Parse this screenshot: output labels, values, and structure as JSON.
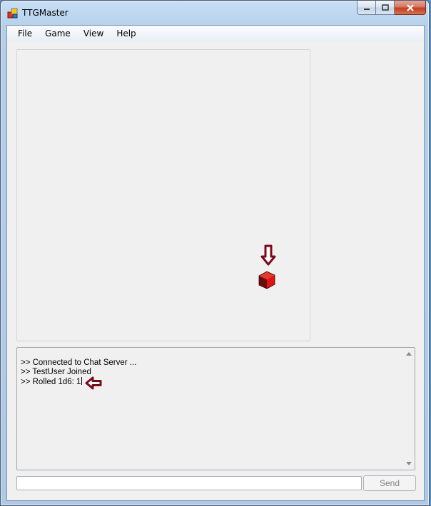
{
  "window": {
    "title": "TTGMaster",
    "app_icon": "ttgmaster-app-icon"
  },
  "titlebar_buttons": [
    "minimize-icon",
    "maximize-icon",
    "close-icon"
  ],
  "menubar": {
    "items": [
      "File",
      "Game",
      "View",
      "Help"
    ]
  },
  "board": {
    "token_icon": "red-cube-die-icon",
    "annotation_icon": "down-arrow-icon"
  },
  "chat": {
    "lines": [
      ">> Connected to Chat Server ...",
      ">> TestUser Joined",
      ">> Rolled 1d6: 1"
    ],
    "annotation_icon": "left-arrow-icon"
  },
  "input": {
    "value": "",
    "placeholder": ""
  },
  "send_button": {
    "label": "Send"
  },
  "colors": {
    "arrow": "#7a0a1a",
    "die": "#e01010",
    "window_frame": "#b5cfe9"
  }
}
